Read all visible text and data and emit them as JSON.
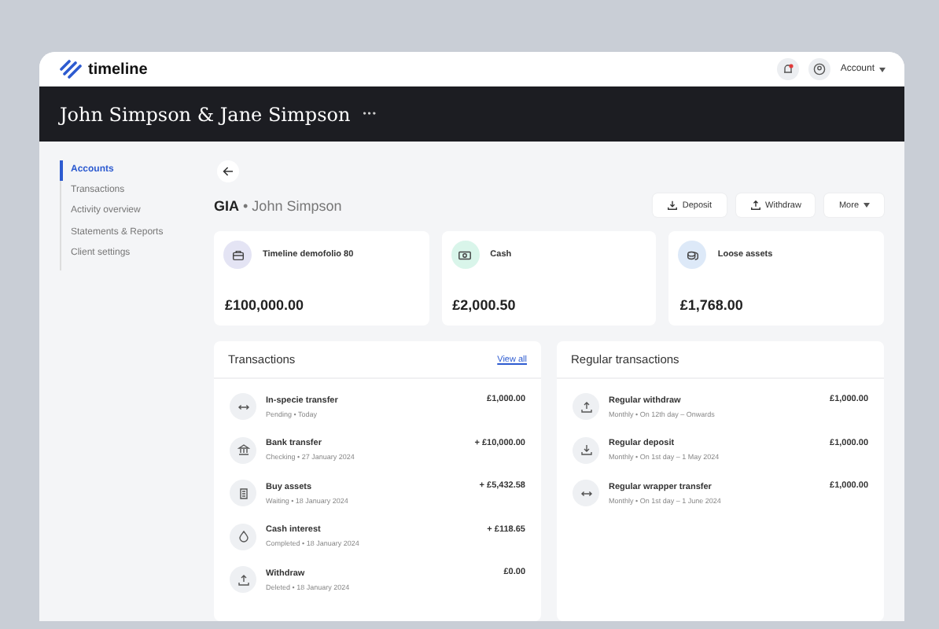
{
  "header": {
    "logo": "timeline",
    "account": "Account",
    "notification": true
  },
  "banner": {
    "title": "John Simpson & Jane Simpson",
    "menu": "•••"
  },
  "sidebar": {
    "items": [
      {
        "label": "Accounts",
        "selected": true
      },
      {
        "label": "Transactions",
        "selected": false
      },
      {
        "label": "Activity overview",
        "selected": false
      },
      {
        "label": "Statements & Reports",
        "selected": false
      },
      {
        "label": "Client settings",
        "selected": false
      }
    ]
  },
  "page": {
    "title": "GIA",
    "separator": "•",
    "subtitle": "John Simpson",
    "actions": [
      {
        "label": "Deposit",
        "kind": "deposit"
      },
      {
        "label": "Withdraw",
        "kind": "withdraw"
      },
      {
        "label": "More",
        "kind": "more"
      }
    ]
  },
  "accounts": [
    {
      "name": "Timeline demofolio 80",
      "amount": "£100,000.00",
      "kind": "portfolio",
      "color": "#e4e4f4"
    },
    {
      "name": "Cash",
      "amount": "£2,000.50",
      "kind": "cash",
      "color": "#d9f5ea"
    },
    {
      "name": "Loose assets",
      "amount": "£1,768.00",
      "kind": "assets",
      "color": "#dde9f8"
    }
  ],
  "transactions": {
    "title": "Transactions",
    "link": "View all",
    "rows": [
      {
        "name": "In-specie transfer",
        "detail": "Pending • Today",
        "amount": "£1,000.00",
        "kind": "transfer"
      },
      {
        "name": "Bank transfer",
        "detail": "Checking • 27 January 2024",
        "amount": "+ £10,000.00",
        "kind": "bank"
      },
      {
        "name": "Buy assets",
        "detail": "Waiting • 18 January 2024",
        "amount": "+ £5,432.58",
        "kind": "buy"
      },
      {
        "name": "Cash interest",
        "detail": "Completed • 18 January 2024",
        "amount": "+ £118.65",
        "kind": "interest"
      },
      {
        "name": "Withdraw",
        "detail": "Deleted • 18 January 2024",
        "amount": "£0.00",
        "kind": "withdraw"
      }
    ]
  },
  "regular_transactions": {
    "title": "Regular transactions",
    "rows": [
      {
        "name": "Regular withdraw",
        "detail": "Monthly • On 12th day – Onwards",
        "amount": "£1,000.00",
        "kind": "withdraw"
      },
      {
        "name": "Regular deposit",
        "detail": "Monthly • On 1st day – 1 May 2024",
        "amount": "£1,000.00",
        "kind": "deposit"
      },
      {
        "name": "Regular wrapper transfer",
        "detail": "Monthly • On 1st day – 1 June 2024",
        "amount": "£1,000.00",
        "kind": "transfer"
      }
    ]
  }
}
